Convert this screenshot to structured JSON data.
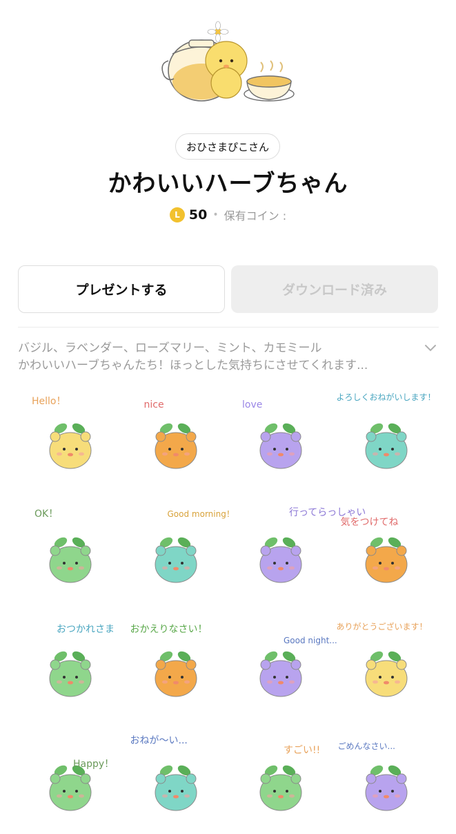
{
  "author": "おひさまぴこさん",
  "title": "かわいいハーブちゃん",
  "price": {
    "coin_letter": "L",
    "amount": "50",
    "separator": "•",
    "owned_label": "保有コイン :"
  },
  "buttons": {
    "gift": "プレゼントする",
    "download": "ダウンロード済み"
  },
  "description": {
    "line1": "バジル、ラベンダー、ローズマリー、ミント、カモミール",
    "line2": "かわいいハーブちゃんたち！ほっとした気持ちにさせてくれます..."
  },
  "colors": {
    "accent_coin": "#f2c12e",
    "chamomile": "#f7dd7a",
    "basil": "#f3a84a",
    "lavender": "#b8a3ee",
    "mint": "#7fd6c6",
    "rosemary": "#8fd68c"
  },
  "stickers": [
    {
      "caption": "Hello！",
      "color": "#f7dd7a",
      "caption_color": "#e8a25a"
    },
    {
      "caption": "nice",
      "color": "#f3a84a",
      "caption_color": "#e06a6a"
    },
    {
      "caption": "love",
      "color": "#b8a3ee",
      "caption_color": "#9a86e6"
    },
    {
      "caption": "よろしくおねがいします！",
      "color": "#7fd6c6",
      "caption_color": "#4aa6c0"
    },
    {
      "caption": "OK！",
      "color": "#8fd68c",
      "caption_color": "#6a9a5a"
    },
    {
      "caption": "Good morning！",
      "color": "#7fd6c6",
      "caption_color": "#d8a23a"
    },
    {
      "caption": "行ってらっしゃい",
      "color": "#b8a3ee",
      "caption_color": "#8c78d6"
    },
    {
      "caption": "気をつけてね",
      "color": "#f3a84a",
      "caption_color": "#e06a6a"
    },
    {
      "caption": "おつかれさま",
      "color": "#8fd68c",
      "caption_color": "#4aa6c0"
    },
    {
      "caption": "おかえりなさい！",
      "color": "#f3a84a",
      "caption_color": "#5aa84a"
    },
    {
      "caption": "Good night...",
      "color": "#b8a3ee",
      "caption_color": "#5a78c0"
    },
    {
      "caption": "ありがとうございます！",
      "color": "#f7dd7a",
      "caption_color": "#e8a25a"
    },
    {
      "caption": "Happy！",
      "color": "#8fd68c",
      "caption_color": "#6a9a5a"
    },
    {
      "caption": "おねが〜い...",
      "color": "#7fd6c6",
      "caption_color": "#5a78c0"
    },
    {
      "caption": "すごい!!",
      "color": "#8fd68c",
      "caption_color": "#e8a25a"
    },
    {
      "caption": "ごめんなさい...",
      "color": "#b8a3ee",
      "caption_color": "#5a78c0"
    }
  ]
}
